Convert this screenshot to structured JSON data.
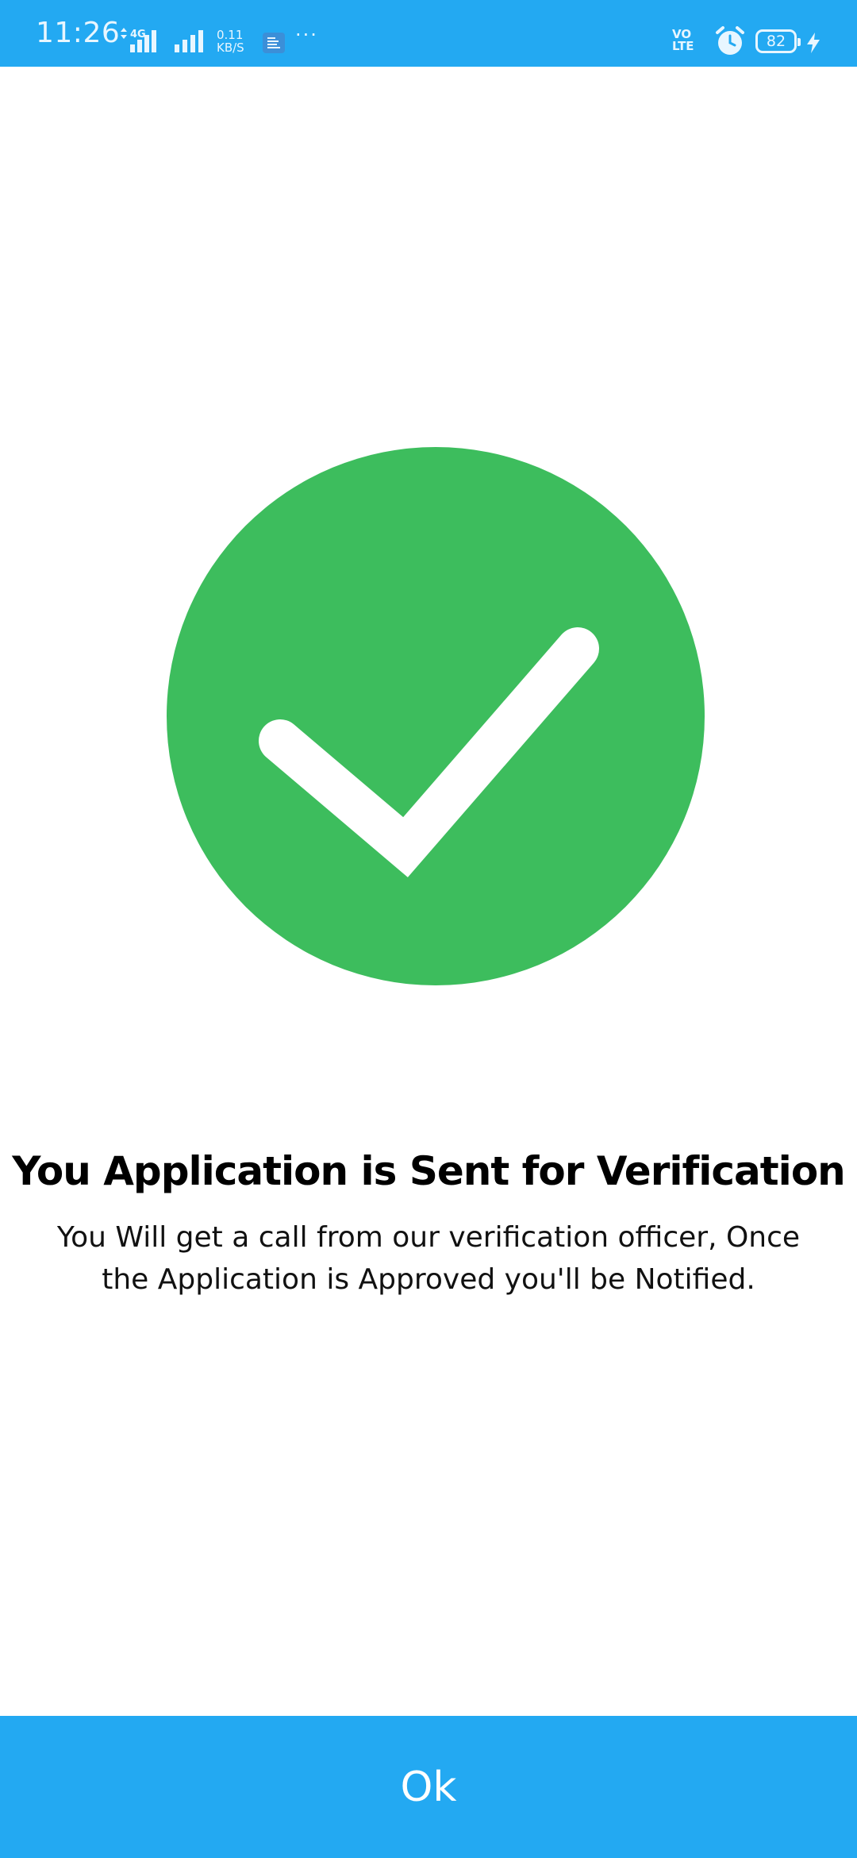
{
  "status_bar": {
    "time": "11:26",
    "network_type": "4G",
    "speed_value": "0.11",
    "speed_unit": "KB/S",
    "overflow_indicator": "···",
    "volte_top": "VO",
    "volte_bottom": "LTE",
    "battery_level": "82",
    "icons": [
      "signal-icon",
      "notification-icon",
      "alarm-icon",
      "battery-icon",
      "charging-icon"
    ]
  },
  "main": {
    "status_icon": "check-circle-icon",
    "title": "You Application is Sent for Verification",
    "message": "You Will get a call from our verification officer, Once the Application is Approved you'll be Notified."
  },
  "footer": {
    "ok_label": "Ok"
  },
  "colors": {
    "primary": "#23a9f2",
    "success": "#3dbd5d",
    "text": "#000000",
    "background": "#ffffff"
  }
}
